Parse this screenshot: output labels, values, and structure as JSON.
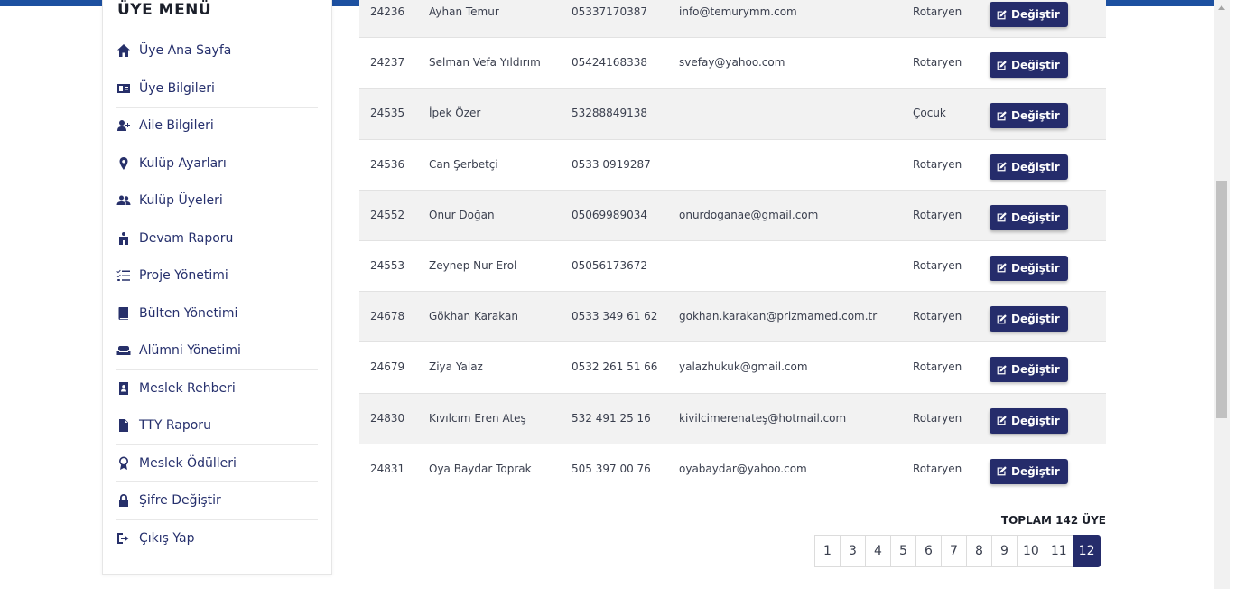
{
  "sidebar": {
    "title": "ÜYE MENÜ",
    "items": [
      {
        "label": "Üye Ana Sayfa",
        "icon": "home-icon"
      },
      {
        "label": "Üye Bilgileri",
        "icon": "id-card-icon"
      },
      {
        "label": "Aile Bilgileri",
        "icon": "user-plus-icon"
      },
      {
        "label": "Kulüp Ayarları",
        "icon": "map-marker-icon"
      },
      {
        "label": "Kulüp Üyeleri",
        "icon": "users-icon"
      },
      {
        "label": "Devam Raporu",
        "icon": "attendance-icon"
      },
      {
        "label": "Proje Yönetimi",
        "icon": "tasks-icon"
      },
      {
        "label": "Bülten Yönetimi",
        "icon": "book-icon"
      },
      {
        "label": "Alümni Yönetimi",
        "icon": "couch-icon"
      },
      {
        "label": "Meslek Rehberi",
        "icon": "address-book-icon"
      },
      {
        "label": "TTY Raporu",
        "icon": "file-icon"
      },
      {
        "label": "Meslek Ödülleri",
        "icon": "award-icon"
      },
      {
        "label": "Şifre Değiştir",
        "icon": "lock-icon"
      },
      {
        "label": "Çıkış Yap",
        "icon": "sign-out-icon"
      }
    ]
  },
  "table": {
    "edit_label": "Değiştir",
    "rows": [
      {
        "id": "24236",
        "name": "Ayhan Temur",
        "phone": "05337170387",
        "email": "info@temurymm.com",
        "type": "Rotaryen"
      },
      {
        "id": "24237",
        "name": "Selman Vefa Yıldırım",
        "phone": "05424168338",
        "email": "svefay@yahoo.com",
        "type": "Rotaryen"
      },
      {
        "id": "24535",
        "name": "İpek Özer",
        "phone": "53288849138",
        "email": "",
        "type": "Çocuk"
      },
      {
        "id": "24536",
        "name": "Can Şerbetçi",
        "phone": "0533 0919287",
        "email": "",
        "type": "Rotaryen"
      },
      {
        "id": "24552",
        "name": "Onur Doğan",
        "phone": "05069989034",
        "email": "onurdoganae@gmail.com",
        "type": "Rotaryen"
      },
      {
        "id": "24553",
        "name": "Zeynep Nur Erol",
        "phone": "05056173672",
        "email": "",
        "type": "Rotaryen"
      },
      {
        "id": "24678",
        "name": "Gökhan Karakan",
        "phone": "0533 349 61 62",
        "email": "gokhan.karakan@prizmamed.com.tr",
        "type": "Rotaryen"
      },
      {
        "id": "24679",
        "name": "Ziya Yalaz",
        "phone": "0532 261 51 66",
        "email": "yalazhukuk@gmail.com",
        "type": "Rotaryen"
      },
      {
        "id": "24830",
        "name": "Kıvılcım Eren Ateş",
        "phone": "532 491 25 16",
        "email": "kivilcimerenateş@hotmail.com",
        "type": "Rotaryen"
      },
      {
        "id": "24831",
        "name": "Oya Baydar Toprak",
        "phone": "505 397 00 76",
        "email": "oyabaydar@yahoo.com",
        "type": "Rotaryen"
      }
    ]
  },
  "total_label": "TOPLAM 142 ÜYE",
  "pagination": {
    "pages": [
      "1",
      "3",
      "4",
      "5",
      "6",
      "7",
      "8",
      "9",
      "10",
      "11",
      "12"
    ],
    "active": "12"
  },
  "colors": {
    "primary": "#252c6b",
    "topbar": "#1d50a0"
  }
}
